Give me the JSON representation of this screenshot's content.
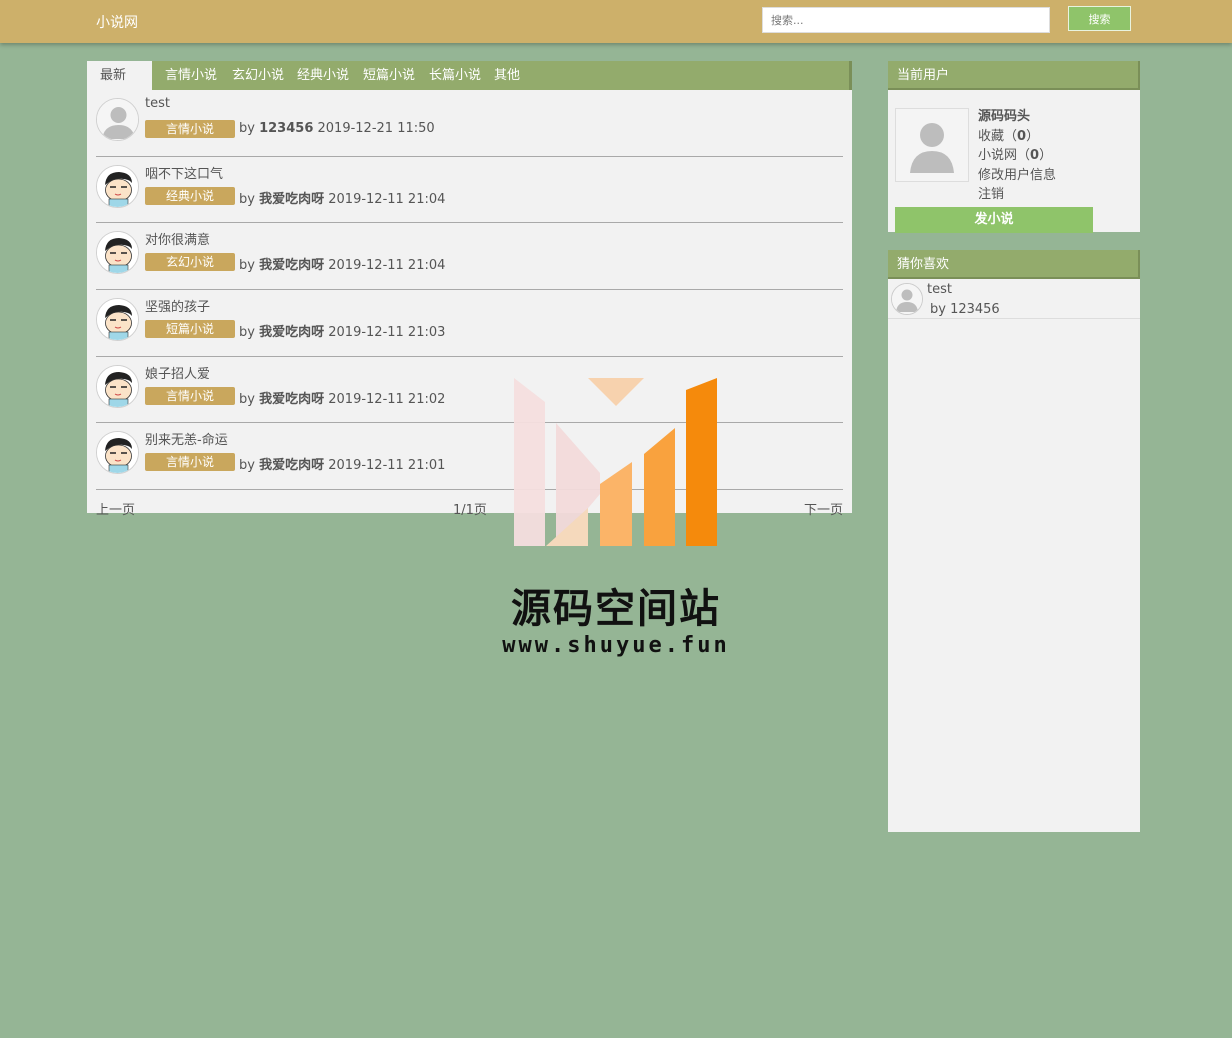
{
  "header": {
    "brand": "小说网",
    "search_placeholder": "搜索...",
    "search_button": "搜索"
  },
  "tabs": [
    {
      "label": "最新",
      "active": true
    },
    {
      "label": "言情小说"
    },
    {
      "label": "玄幻小说"
    },
    {
      "label": "经典小说"
    },
    {
      "label": "短篇小说"
    },
    {
      "label": "长篇小说"
    },
    {
      "label": "其他"
    }
  ],
  "posts": [
    {
      "title": "test",
      "category": "言情小说",
      "by": "by",
      "author": "123456",
      "time": "2019-12-21 11:50",
      "avatar": "default-user-icon"
    },
    {
      "title": "咽不下这口气",
      "category": "经典小说",
      "by": "by",
      "author": "我爱吃肉呀",
      "time": "2019-12-11 21:04",
      "avatar": "cartoon-boy-icon"
    },
    {
      "title": "对你很满意",
      "category": "玄幻小说",
      "by": "by",
      "author": "我爱吃肉呀",
      "time": "2019-12-11 21:04",
      "avatar": "cartoon-boy-icon"
    },
    {
      "title": "坚强的孩子",
      "category": "短篇小说",
      "by": "by",
      "author": "我爱吃肉呀",
      "time": "2019-12-11 21:03",
      "avatar": "cartoon-boy-icon"
    },
    {
      "title": "娘子招人爱",
      "category": "言情小说",
      "by": "by",
      "author": "我爱吃肉呀",
      "time": "2019-12-11 21:02",
      "avatar": "cartoon-boy-icon"
    },
    {
      "title": "别来无恙-命运",
      "category": "言情小说",
      "by": "by",
      "author": "我爱吃肉呀",
      "time": "2019-12-11 21:01",
      "avatar": "cartoon-boy-icon"
    }
  ],
  "pager": {
    "prev": "上一页",
    "info": "1/1页",
    "next": "下一页"
  },
  "user_panel": {
    "heading": "当前用户",
    "username": "源码码头",
    "favorites_label": "收藏（",
    "favorites_count": "0",
    "favorites_close": "）",
    "novels_label": "小说网（",
    "novels_count": "0",
    "novels_close": "）",
    "edit_profile": "修改用户信息",
    "logout": "注销",
    "post_button": "发小说"
  },
  "guess_panel": {
    "heading": "猜你喜欢",
    "items": [
      {
        "title": "test",
        "by": "by 123456"
      }
    ]
  },
  "watermark": {
    "title": "源码空间站",
    "url": "www.shuyue.fun"
  },
  "colors": {
    "background": "#95b595",
    "header": "#cdb06a",
    "panel_head": "#93ab6c",
    "tag": "#c9a75d",
    "button_green": "#8fc46a"
  }
}
